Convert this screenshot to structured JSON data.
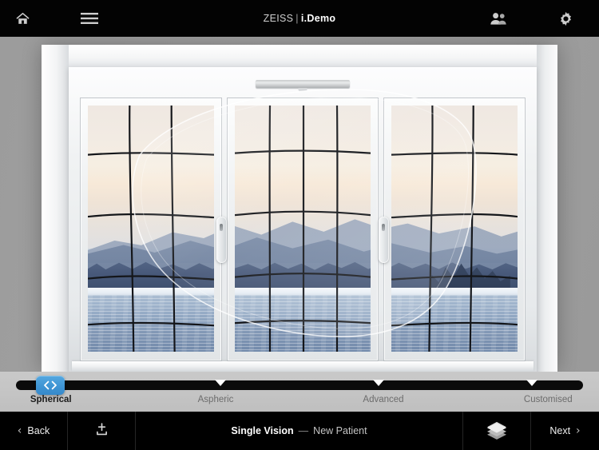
{
  "header": {
    "title_brand": "ZEISS",
    "title_separator": "|",
    "title_product": "i.Demo",
    "home_icon": "home-icon",
    "menu_icon": "hamburger-menu-icon",
    "users_icon": "users-icon",
    "settings_icon": "gear-icon"
  },
  "stage": {
    "scene_name": "lake-and-mountains-through-window",
    "overlay_name": "spectacle-lens-distortion-overlay"
  },
  "stepper": {
    "active_index": 0,
    "thumb_icon": "left-right-chevrons-icon",
    "track_color": "#0b0b0b",
    "thumb_color": "#3f95d4",
    "steps": [
      {
        "label": "Spherical",
        "position_pct": 6
      },
      {
        "label": "Aspheric",
        "position_pct": 36
      },
      {
        "label": "Advanced",
        "position_pct": 64
      },
      {
        "label": "Customised",
        "position_pct": 91
      }
    ]
  },
  "bottom_bar": {
    "back_label": "Back",
    "back_chevron": "‹",
    "add_icon": "add-to-tray-icon",
    "layers_icon": "layers-stack-icon",
    "status_primary": "Single Vision",
    "status_dash": "—",
    "status_secondary": "New Patient",
    "next_label": "Next",
    "next_chevron": "›"
  }
}
